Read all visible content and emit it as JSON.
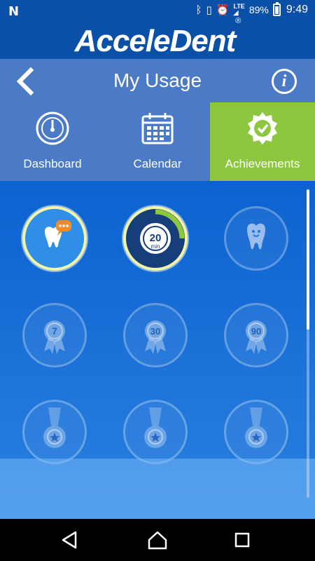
{
  "status": {
    "battery": "89%",
    "time": "9:49",
    "network": "LTE"
  },
  "brand": {
    "name": "AcceleDent",
    "trademark": "®"
  },
  "header": {
    "title": "My Usage"
  },
  "tabs": [
    {
      "label": "Dashboard",
      "icon": "speedometer-icon"
    },
    {
      "label": "Calendar",
      "icon": "calendar-icon"
    },
    {
      "label": "Achievements",
      "icon": "award-icon",
      "active": true
    }
  ],
  "badges": [
    {
      "name": "tooth-chat",
      "earned": true
    },
    {
      "name": "20-min",
      "text": "20",
      "subtext": "min",
      "earned": true
    },
    {
      "name": "tooth",
      "earned": false
    },
    {
      "name": "ribbon-7",
      "text": "7",
      "earned": false
    },
    {
      "name": "ribbon-30",
      "text": "30",
      "earned": false
    },
    {
      "name": "ribbon-90",
      "text": "90",
      "earned": false
    },
    {
      "name": "medal-1",
      "earned": false
    },
    {
      "name": "medal-2",
      "earned": false
    },
    {
      "name": "medal-3",
      "earned": false
    }
  ],
  "colors": {
    "brand": "#0a4fa8",
    "header": "#4b7ac7",
    "active_tab": "#8dc63f",
    "badge_ring": "#f2f5a8"
  }
}
